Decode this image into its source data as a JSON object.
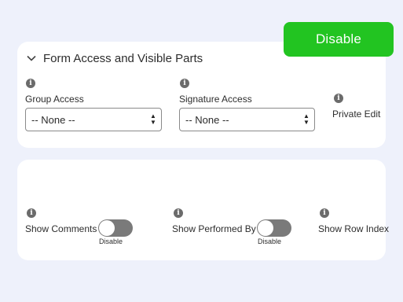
{
  "header_button": {
    "label": "Disable",
    "color": "#22c421"
  },
  "section": {
    "title": "Form Access and Visible Parts",
    "icon": "chevron-down-icon"
  },
  "fields": {
    "group_access": {
      "label": "Group Access",
      "value": "-- None --"
    },
    "signature_access": {
      "label": "Signature Access",
      "value": "-- None --"
    },
    "private_edit": {
      "label": "Private Edit"
    }
  },
  "visibility": {
    "show_comments": {
      "label": "Show Comments",
      "state_text": "Disable",
      "enabled": false
    },
    "show_performed_by": {
      "label": "Show Performed By",
      "state_text": "Disable",
      "enabled": false
    },
    "show_row_index": {
      "label": "Show Row Index"
    }
  },
  "info_icon_glyph": "i"
}
